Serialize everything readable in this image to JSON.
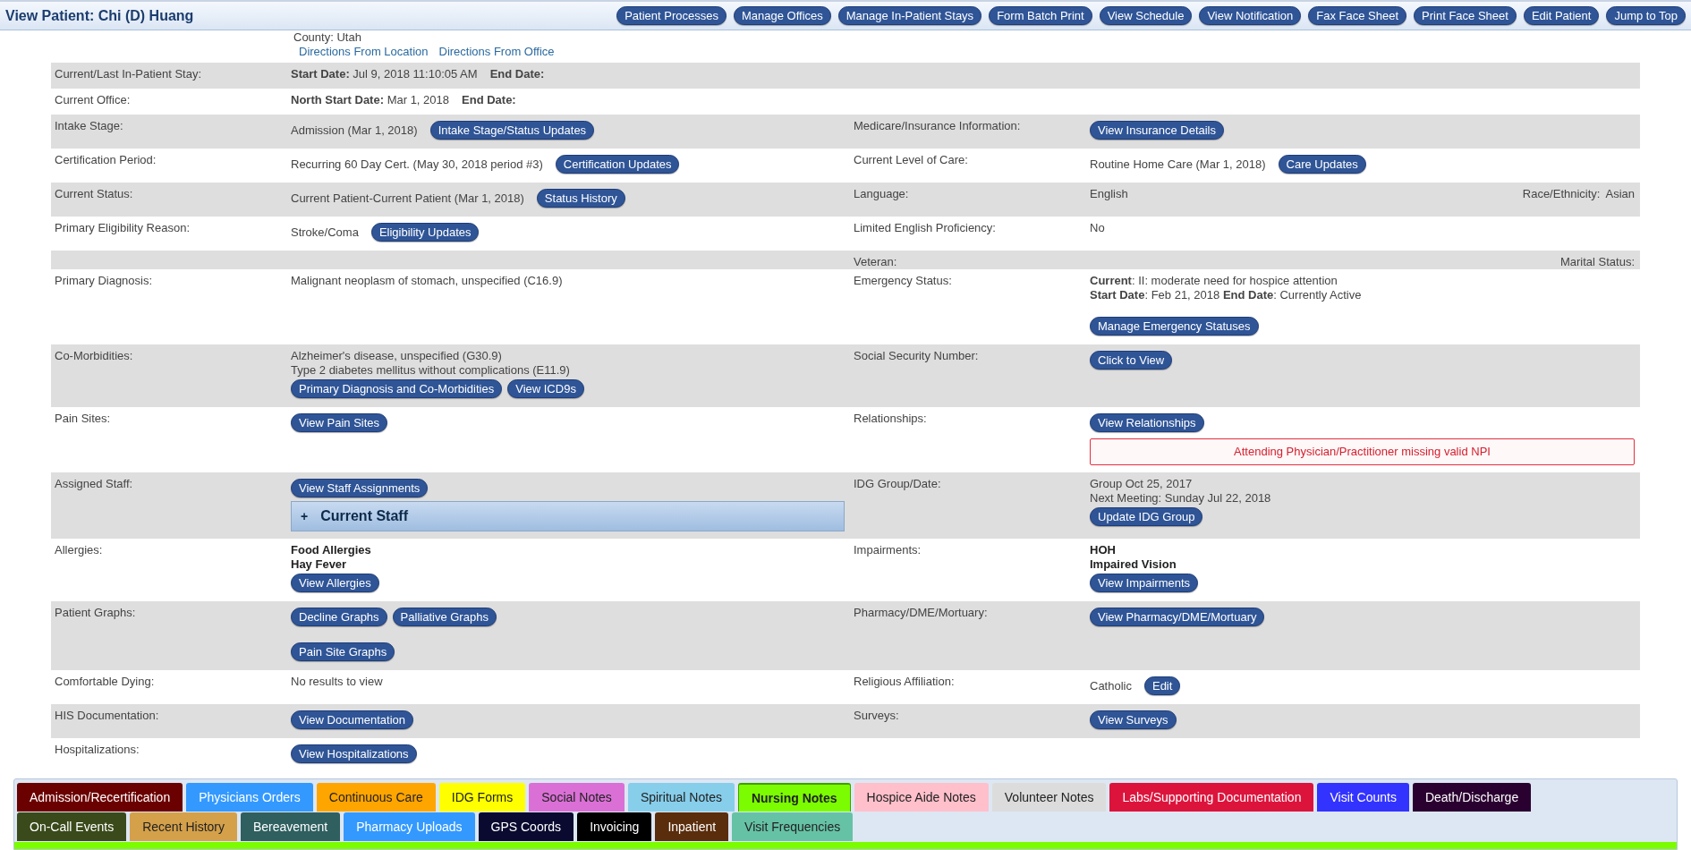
{
  "header": {
    "title": "View Patient: Chi (D) Huang",
    "buttons": [
      "Patient Processes",
      "Manage Offices",
      "Manage In-Patient Stays",
      "Form Batch Print",
      "View Schedule",
      "View Notification",
      "Fax Face Sheet",
      "Print Face Sheet",
      "Edit Patient",
      "Jump to Top"
    ]
  },
  "location": {
    "county": "County: Utah",
    "links": [
      "Directions From Location",
      "Directions From Office"
    ]
  },
  "rows": [
    {
      "left": {
        "label": "Current/Last In-Patient Stay:",
        "lines": [
          {
            "parts": [
              {
                "kind": "text",
                "text": "**Start Date:** Jul 9, 2018 11:10:05 AM"
              },
              {
                "kind": "text",
                "text": "**End Date:**"
              }
            ]
          }
        ]
      }
    },
    {
      "left": {
        "label": "Current Office:",
        "lines": [
          {
            "parts": [
              {
                "kind": "text",
                "text": "**North Start Date:** Mar 1, 2018"
              },
              {
                "kind": "text",
                "text": "**End Date:**"
              }
            ]
          }
        ]
      }
    },
    {
      "left": {
        "label": "Intake Stage:",
        "lines": [
          {
            "parts": [
              {
                "kind": "text",
                "text": "Admission (Mar 1, 2018)"
              },
              {
                "kind": "button",
                "text": "Intake Stage/Status Updates"
              }
            ]
          }
        ]
      },
      "right": {
        "label": "Medicare/Insurance Information:",
        "lines": [
          {
            "parts": [
              {
                "kind": "button",
                "text": "View Insurance Details"
              }
            ]
          }
        ]
      }
    },
    {
      "left": {
        "label": "Certification Period:",
        "lines": [
          {
            "parts": [
              {
                "kind": "text",
                "text": "Recurring 60 Day Cert. (May 30, 2018 period #3)"
              },
              {
                "kind": "button",
                "text": "Certification Updates"
              }
            ]
          }
        ]
      },
      "right": {
        "label": "Current Level of Care:",
        "lines": [
          {
            "parts": [
              {
                "kind": "text",
                "text": "Routine Home Care (Mar 1, 2018)"
              },
              {
                "kind": "button",
                "text": "Care Updates"
              }
            ]
          }
        ]
      }
    },
    {
      "left": {
        "label": "Current Status:",
        "lines": [
          {
            "parts": [
              {
                "kind": "text",
                "text": "Current Patient-Current Patient (Mar 1, 2018)"
              },
              {
                "kind": "button",
                "text": "Status History"
              }
            ]
          }
        ]
      },
      "right": {
        "label": "Language:",
        "lines": [
          {
            "parts": [
              {
                "kind": "text",
                "text": "English"
              }
            ]
          }
        ],
        "aside": "Race/Ethnicity:",
        "aside_value": "Asian"
      }
    },
    {
      "left": {
        "label": "Primary Eligibility Reason:",
        "lines": [
          {
            "parts": [
              {
                "kind": "text",
                "text": "Stroke/Coma"
              },
              {
                "kind": "button",
                "text": "Eligibility Updates"
              }
            ]
          }
        ]
      },
      "right": {
        "label": "Limited English Proficiency:",
        "lines": [
          {
            "parts": [
              {
                "kind": "text",
                "text": "No"
              }
            ]
          }
        ]
      }
    },
    {
      "right": {
        "label": "Veteran:",
        "aside": "Marital Status:"
      }
    },
    {
      "left": {
        "label": "Primary Diagnosis:",
        "lines": [
          {
            "parts": [
              {
                "kind": "text",
                "text": "Malignant neoplasm of stomach, unspecified (C16.9)"
              }
            ]
          }
        ]
      },
      "right": {
        "label": "Emergency Status:",
        "lines": [
          {
            "parts": [
              {
                "kind": "text",
                "text": "**Current**: II: moderate need for hospice attention"
              }
            ]
          },
          {
            "parts": [
              {
                "kind": "text",
                "text": "**Start Date**: Feb 21, 2018 **End Date**: Currently Active"
              }
            ]
          },
          {
            "gap": true,
            "parts": [
              {
                "kind": "button",
                "text": "Manage Emergency Statuses"
              }
            ]
          }
        ]
      }
    },
    {
      "left": {
        "label": "Co-Morbidities:",
        "lines": [
          {
            "parts": [
              {
                "kind": "text",
                "text": "Alzheimer's disease, unspecified (G30.9)"
              }
            ]
          },
          {
            "parts": [
              {
                "kind": "text",
                "text": "Type 2 diabetes mellitus without complications (E11.9)"
              }
            ]
          },
          {
            "parts": [
              {
                "kind": "button",
                "text": "Primary Diagnosis and Co-Morbidities"
              },
              {
                "kind": "button",
                "text": "View ICD9s"
              }
            ]
          }
        ]
      },
      "right": {
        "label": "Social Security Number:",
        "lines": [
          {
            "parts": [
              {
                "kind": "button",
                "text": "Click to View"
              }
            ]
          }
        ]
      }
    },
    {
      "left": {
        "label": "Pain Sites:",
        "lines": [
          {
            "parts": [
              {
                "kind": "button",
                "text": "View Pain Sites"
              }
            ]
          }
        ]
      },
      "right": {
        "label": "Relationships:",
        "lines": [
          {
            "parts": [
              {
                "kind": "button",
                "text": "View Relationships"
              }
            ]
          },
          {
            "parts": [
              {
                "kind": "alert",
                "text": "Attending Physician/Practitioner missing valid NPI"
              }
            ]
          }
        ]
      }
    },
    {
      "left": {
        "label": "Assigned Staff:",
        "lines": [
          {
            "parts": [
              {
                "kind": "button",
                "text": "View Staff Assignments"
              }
            ]
          },
          {
            "parts": [
              {
                "kind": "panel",
                "icon": "+",
                "text": "Current Staff"
              }
            ]
          }
        ]
      },
      "right": {
        "label": "IDG Group/Date:",
        "lines": [
          {
            "parts": [
              {
                "kind": "text",
                "text": "Group Oct 25, 2017"
              }
            ]
          },
          {
            "parts": [
              {
                "kind": "text",
                "text": "Next Meeting: Sunday Jul 22, 2018"
              }
            ]
          },
          {
            "parts": [
              {
                "kind": "button",
                "text": "Update IDG Group"
              }
            ]
          }
        ]
      }
    },
    {
      "left": {
        "label": "Allergies:",
        "lines": [
          {
            "parts": [
              {
                "kind": "bold",
                "text": "Food Allergies"
              }
            ]
          },
          {
            "parts": [
              {
                "kind": "bold",
                "text": "Hay Fever"
              }
            ]
          },
          {
            "parts": [
              {
                "kind": "button",
                "text": "View Allergies"
              }
            ]
          }
        ]
      },
      "right": {
        "label": "Impairments:",
        "lines": [
          {
            "parts": [
              {
                "kind": "bold",
                "text": "HOH"
              }
            ]
          },
          {
            "parts": [
              {
                "kind": "bold",
                "text": "Impaired Vision"
              }
            ]
          },
          {
            "parts": [
              {
                "kind": "button",
                "text": "View Impairments"
              }
            ]
          }
        ]
      }
    },
    {
      "left": {
        "label": "Patient Graphs:",
        "lines": [
          {
            "parts": [
              {
                "kind": "button",
                "text": "Decline Graphs"
              },
              {
                "kind": "button",
                "text": "Palliative Graphs"
              }
            ]
          },
          {
            "gap": true,
            "parts": [
              {
                "kind": "button",
                "text": "Pain Site Graphs"
              }
            ]
          }
        ]
      },
      "right": {
        "label": "Pharmacy/DME/Mortuary:",
        "lines": [
          {
            "parts": [
              {
                "kind": "button",
                "text": "View Pharmacy/DME/Mortuary"
              }
            ]
          }
        ]
      }
    },
    {
      "left": {
        "label": "Comfortable Dying:",
        "lines": [
          {
            "parts": [
              {
                "kind": "text",
                "text": "No results to view"
              }
            ]
          }
        ]
      },
      "right": {
        "label": "Religious Affiliation:",
        "lines": [
          {
            "parts": [
              {
                "kind": "text",
                "text": "Catholic"
              },
              {
                "kind": "button",
                "text": "Edit"
              }
            ]
          }
        ]
      }
    },
    {
      "left": {
        "label": "HIS Documentation:",
        "lines": [
          {
            "parts": [
              {
                "kind": "button",
                "text": "View Documentation"
              }
            ]
          }
        ]
      },
      "right": {
        "label": "Surveys:",
        "lines": [
          {
            "parts": [
              {
                "kind": "button",
                "text": "View Surveys"
              }
            ]
          }
        ]
      }
    },
    {
      "left": {
        "label": "Hospitalizations:",
        "lines": [
          {
            "parts": [
              {
                "kind": "button",
                "text": "View Hospitalizations"
              }
            ]
          }
        ]
      }
    }
  ],
  "tab_rows": [
    [
      {
        "label": "Admission/Recertification",
        "color": "#6b0000",
        "selected": false
      },
      {
        "label": "Physicians Orders",
        "color": "#3399ff",
        "selected": false
      },
      {
        "label": "Continuous Care",
        "color": "#ffa500",
        "selected": false
      },
      {
        "label": "IDG Forms",
        "color": "#ffff00",
        "selected": false
      },
      {
        "label": "Social Notes",
        "color": "#da70d6",
        "selected": false
      },
      {
        "label": "Spiritual Notes",
        "color": "#87ceeb",
        "selected": false
      },
      {
        "label": "Nursing Notes",
        "color": "#7cfc00",
        "selected": true
      },
      {
        "label": "Hospice Aide Notes",
        "color": "#ffc0cb",
        "selected": false
      },
      {
        "label": "Volunteer Notes",
        "color": "#dcdcdc",
        "selected": false
      },
      {
        "label": "Labs/Supporting Documentation",
        "color": "#dc143c",
        "selected": false
      },
      {
        "label": "Visit Counts",
        "color": "#3333ff",
        "selected": false
      },
      {
        "label": "Death/Discharge",
        "color": "#2a0030",
        "selected": false
      }
    ],
    [
      {
        "label": "On-Call Events",
        "color": "#3a4a1a",
        "selected": false
      },
      {
        "label": "Recent History",
        "color": "#d4a04a",
        "selected": false
      },
      {
        "label": "Bereavement",
        "color": "#2f5f5f",
        "selected": false
      },
      {
        "label": "Pharmacy Uploads",
        "color": "#3399ff",
        "selected": false
      },
      {
        "label": "GPS Coords",
        "color": "#0a0a30",
        "selected": false
      },
      {
        "label": "Invoicing",
        "color": "#000000",
        "selected": false
      },
      {
        "label": "Inpatient",
        "color": "#5a2d0c",
        "selected": false
      },
      {
        "label": "Visit Frequencies",
        "color": "#66c2a5",
        "selected": false
      }
    ]
  ]
}
